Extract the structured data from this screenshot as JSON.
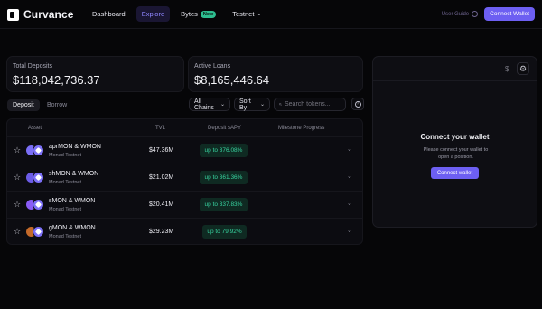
{
  "header": {
    "app_name": "Curvance",
    "nav": [
      {
        "label": "Dashboard"
      },
      {
        "label": "Explore"
      },
      {
        "label": "Bytes",
        "badge": "New"
      },
      {
        "label": "Testnet"
      }
    ],
    "user_guide": "User Guide",
    "connect_label": "Connect Wallet"
  },
  "stats": {
    "deposits_label": "Total Deposits",
    "deposits_value": "$118,042,736.37",
    "loans_label": "Active Loans",
    "loans_value": "$8,165,446.64"
  },
  "tabs": [
    {
      "label": "Deposit"
    },
    {
      "label": "Borrow"
    }
  ],
  "filters": {
    "chains": "All Chains",
    "sort": "Sort By",
    "search_placeholder": "Search tokens..."
  },
  "table": {
    "columns": [
      "Asset",
      "TVL",
      "Deposit sAPY",
      "Milestone Progress"
    ],
    "rows": [
      {
        "asset": "aprMON & WMON",
        "network": "Monad Testnet",
        "tvl": "$47.36M",
        "apy": "up to 376.08%"
      },
      {
        "asset": "shMON & WMON",
        "network": "Monad Testnet",
        "tvl": "$21.02M",
        "apy": "up to 361.36%"
      },
      {
        "asset": "sMON & WMON",
        "network": "Monad Testnet",
        "tvl": "$20.41M",
        "apy": "up to 337.83%"
      },
      {
        "asset": "gMON & WMON",
        "network": "Monad Testnet",
        "tvl": "$29.23M",
        "apy": "up to 79.92%"
      }
    ]
  },
  "panel": {
    "currency_symbol": "$",
    "title": "Connect your wallet",
    "text": "Please connect your wallet to open a position.",
    "button_label": "Connect wallet"
  },
  "colors": {
    "accent": "#6d5ff2",
    "apy_green": "#38d4a0",
    "background": "#060608"
  },
  "icons": {
    "row_star": "star-icon",
    "row_expand": "chevron-down-icon",
    "settings": "gear-icon"
  }
}
